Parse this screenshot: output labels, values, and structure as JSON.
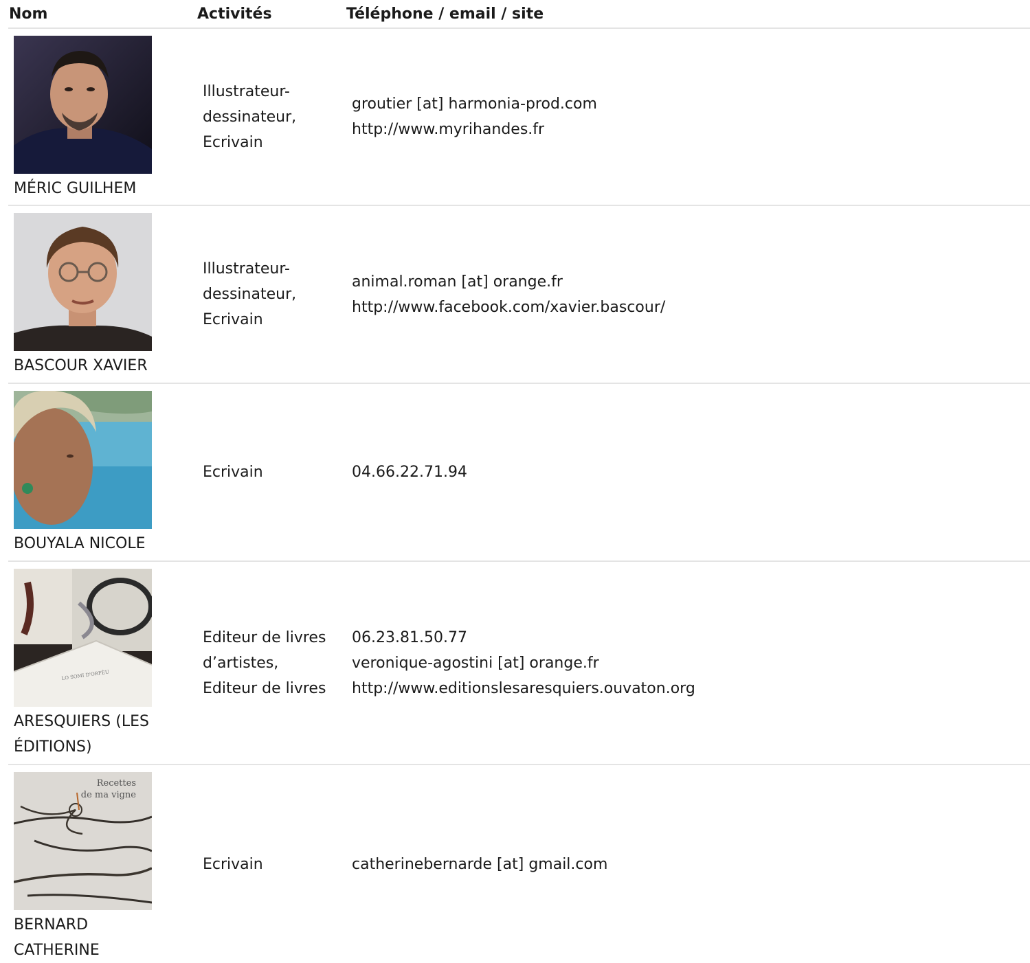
{
  "columns": {
    "name": "Nom",
    "activities": "Activités",
    "contact": "Téléphone / email / site"
  },
  "rows": [
    {
      "photo": "portrait-photo",
      "name": "MÉRIC GUILHEM",
      "activities": [
        "Illustrateur-",
        "dessinateur,",
        "Ecrivain"
      ],
      "contact": [
        "groutier [at] harmonia-prod.com",
        "http://www.myrihandes.fr"
      ]
    },
    {
      "photo": "portrait-photo",
      "name": "BASCOUR XAVIER",
      "activities": [
        "Illustrateur-",
        "dessinateur,",
        "Ecrivain"
      ],
      "contact": [
        "animal.roman [at] orange.fr",
        "http://www.facebook.com/xavier.bascour/"
      ]
    },
    {
      "photo": "portrait-photo",
      "name": "BOUYALA NICOLE",
      "activities": [
        "Ecrivain"
      ],
      "contact": [
        "04.66.22.71.94"
      ]
    },
    {
      "photo": "artist-book-photo",
      "name": "ARESQUIERS (LES ÉDITIONS)",
      "activities": [
        "Editeur de livres",
        "d’artistes,",
        "Editeur de livres"
      ],
      "contact": [
        "06.23.81.50.77",
        "veronique-agostini [at] orange.fr",
        "http://www.editionslesaresquiers.ouvaton.org"
      ]
    },
    {
      "photo": "book-cover-photo",
      "name": "BERNARD CATHERINE",
      "activities": [
        "Ecrivain"
      ],
      "contact": [
        "catherinebernarde [at] gmail.com"
      ],
      "book_cover_text": [
        "Recettes",
        "de ma vigne"
      ]
    }
  ]
}
